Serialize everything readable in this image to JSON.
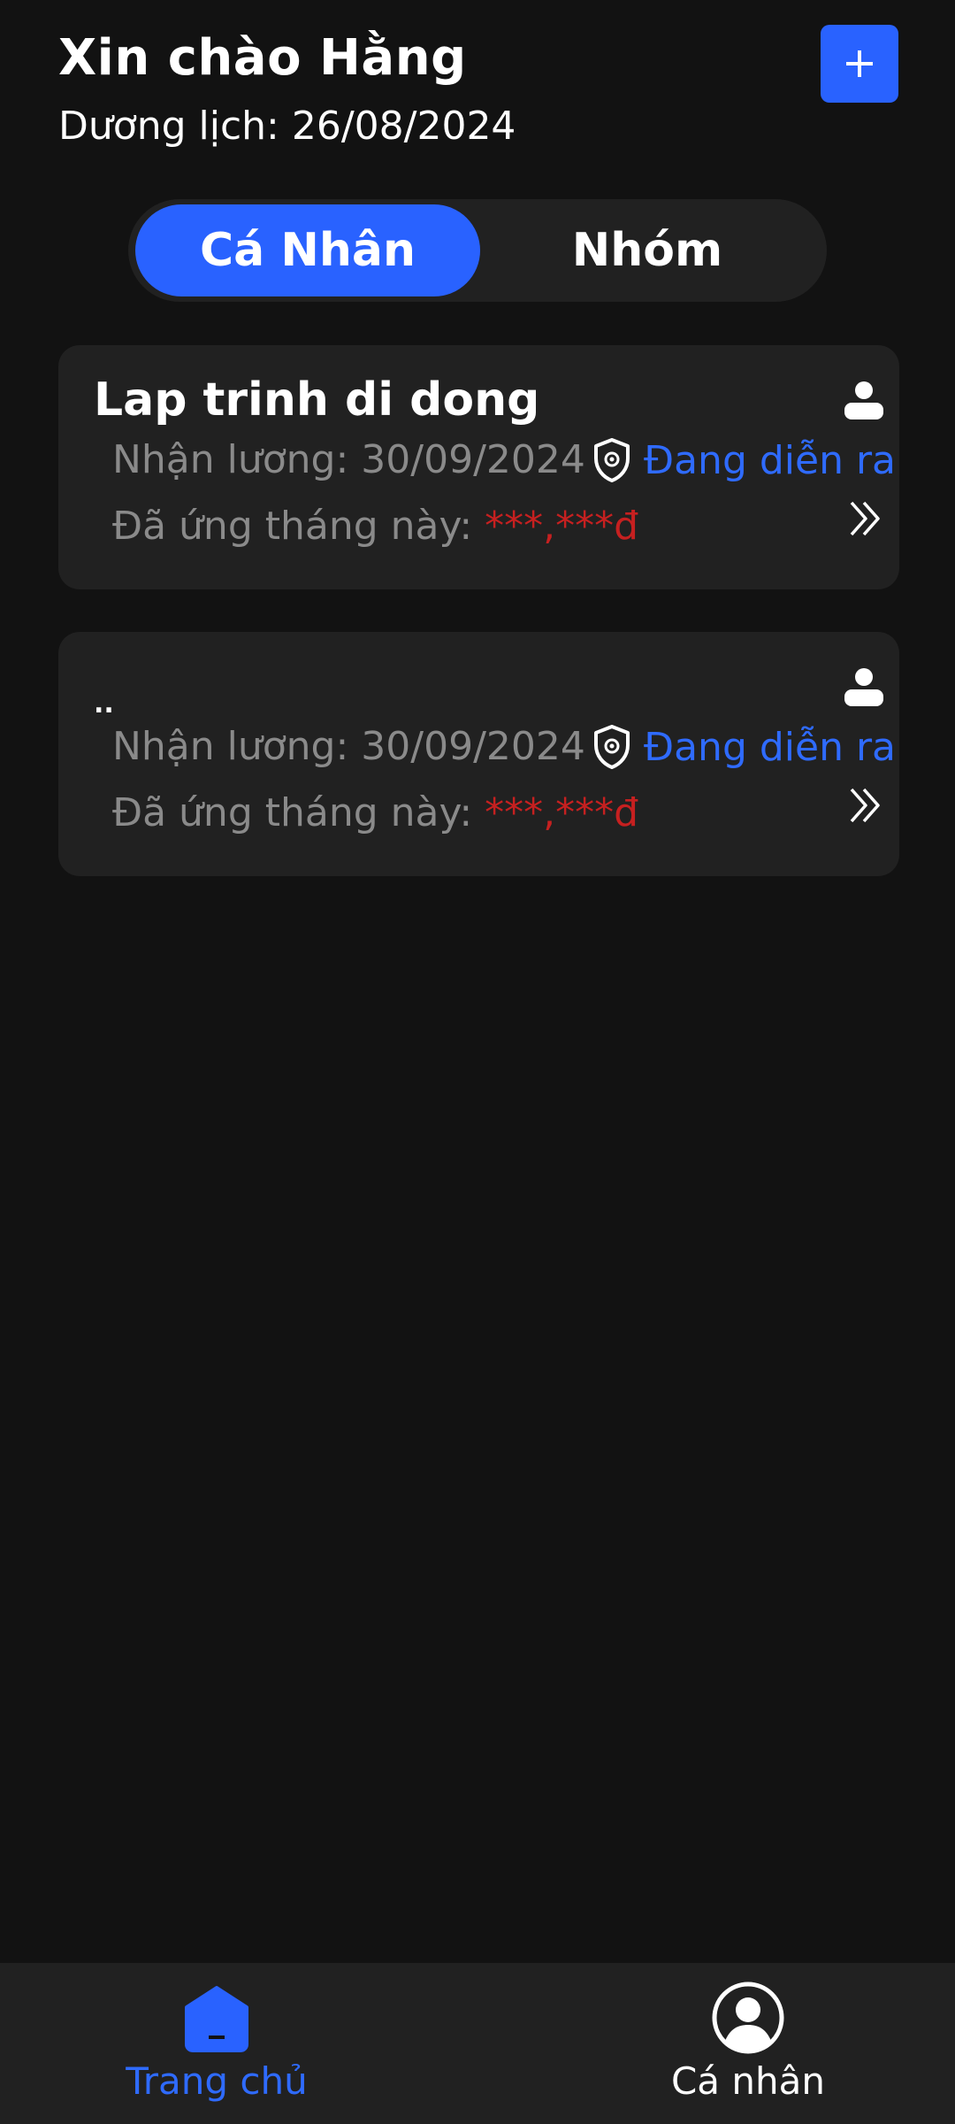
{
  "header": {
    "greeting": "Xin chào Hằng",
    "date_label": "Dương lịch: 26/08/2024",
    "add_button_icon": "plus-icon"
  },
  "tabs": {
    "items": [
      {
        "label": "Cá Nhân",
        "active": true
      },
      {
        "label": "Nhóm",
        "active": false
      }
    ]
  },
  "cards": [
    {
      "title": "Lap trinh di dong",
      "salary_label": "Nhận lương: 30/09/2024",
      "status": "Đang diễn ra",
      "advance_label": "Đã ứng tháng này: ",
      "advance_value": "***,***đ",
      "type_icon": "person-icon"
    },
    {
      "title": "..",
      "salary_label": "Nhận lương: 30/09/2024",
      "status": "Đang diễn ra",
      "advance_label": "Đã ứng tháng này: ",
      "advance_value": "***,***đ",
      "type_icon": "person-icon"
    }
  ],
  "bottom_nav": {
    "items": [
      {
        "label": "Trang chủ",
        "icon": "home-icon",
        "active": true
      },
      {
        "label": "Cá nhân",
        "icon": "user-circle-icon",
        "active": false
      }
    ]
  },
  "colors": {
    "background": "#121212",
    "surface": "#212121",
    "accent": "#2962ff",
    "status_text": "#2f6bff",
    "masked_value": "#c62020",
    "muted_text": "#8a8a8a"
  }
}
